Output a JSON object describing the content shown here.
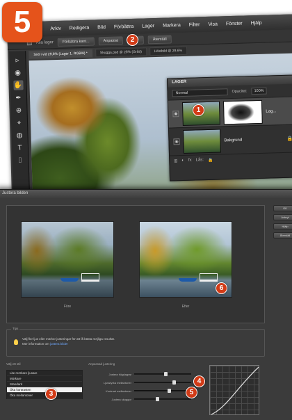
{
  "step_number": "5",
  "menu": [
    "Arkiv",
    "Redigera",
    "Bild",
    "Förbättra",
    "Lager",
    "Markera",
    "Filter",
    "Visa",
    "Fönster",
    "Hjälp"
  ],
  "options_bar": {
    "sample_all_layers": "Alla lager",
    "buttons": [
      "Förbättra kant...",
      "Anpassa",
      "Klar",
      "Återställ"
    ]
  },
  "doc_tabs": [
    "Snö i vid 29,6% (Lager 1, RGB/8) *",
    "Skugga.psd @ 25% (Grått)",
    "Höstbild @ 29,6%"
  ],
  "tools": [
    "▹",
    "◉",
    "✋",
    "✒",
    "⊕",
    "⌖",
    "◍",
    "T",
    "⌷"
  ],
  "layers_panel": {
    "title": "LAGER",
    "blend_mode": "Normal",
    "opacity_label": "Opacitet:",
    "opacity_value": "100%",
    "layers": [
      {
        "name": "Lag...",
        "active": true
      },
      {
        "name": "Bakgrund",
        "active": false
      }
    ],
    "footer": [
      "⊞",
      "◐",
      "fx",
      "Lås:",
      "🔒"
    ]
  },
  "dialog": {
    "title": "Justera bilden",
    "preview_before": "Före",
    "preview_after": "Efter",
    "side_buttons": [
      "OK",
      "Avbryt",
      "Hjälp",
      "Återställ"
    ],
    "tips_label": "Tips",
    "tips_line1": "Välj fler ljus eller mörker justeringar för att få bästa möjliga resultat.",
    "tips_line2": "Mer information om",
    "tips_link": "justera bilder",
    "presets_label": "Välj ett stil",
    "presets": [
      "Lite mörkare ljusare",
      "Mörkare",
      "Standard",
      "Öka kontrasten",
      "Öka mellantoner"
    ],
    "presets_selected": 3,
    "custom_label": "Anpassad justering",
    "sliders": [
      {
        "label": "Justera högdagrar",
        "value": 0.55
      },
      {
        "label": "Ljusstyrka mellantoner",
        "value": 0.7
      },
      {
        "label": "Kontrast mellantoner",
        "value": 0.62
      },
      {
        "label": "Justera skuggor",
        "value": 0.4
      }
    ]
  },
  "badges": [
    "1",
    "2",
    "3",
    "4",
    "5",
    "6"
  ]
}
